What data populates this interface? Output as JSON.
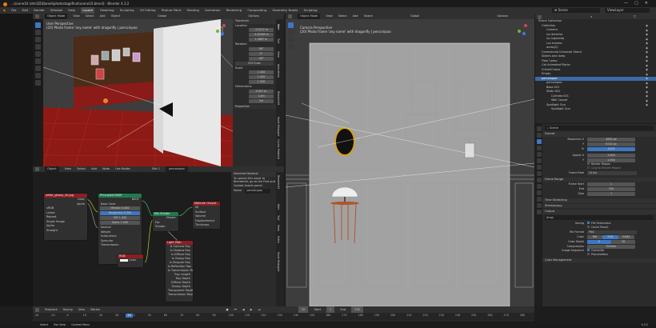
{
  "title": "...\\scene10 (dm\\3D\\Daniel\\photostagefinal\\scene10.blend] - Blender 4.3.2",
  "menu": [
    "File",
    "Edit",
    "Render",
    "Window",
    "Help"
  ],
  "workspace_tabs": [
    "Layout",
    "Modeling",
    "Sculpting",
    "UV Editing",
    "Texture Paint",
    "Shading",
    "Animation",
    "Rendering",
    "Compositing",
    "Geometry Nodes",
    "Scripting"
  ],
  "active_workspace": "Layout",
  "scene_name": "Scene",
  "view_layer": "ViewLayer",
  "left_viewport": {
    "mode": "Object Mode",
    "menus": [
      "View",
      "Select",
      "Add",
      "Object"
    ],
    "orientation": "Global",
    "options": "Options",
    "info_line1": "User Perspective",
    "info_line2": "(20) Photo frame 'any name' with dragonfly | percoinpoo",
    "sidebar_tabs": [
      "Item",
      "Tool",
      "View"
    ],
    "transform": {
      "header": "Transform",
      "location_label": "Location",
      "location": [
        "-3.5222 m",
        "-3.40909 m",
        "1.5887 m"
      ],
      "rotation_label": "Rotation",
      "rotation": [
        "90°",
        "0°",
        "-40°"
      ],
      "rot_mode": "XYZ Euler",
      "scale_label": "Scale",
      "scale": [
        "1.420",
        "1.420",
        "1.420"
      ],
      "dims_label": "Dimensions",
      "dims": [
        "0.957 m",
        "1.4m",
        "1m"
      ],
      "properties": "Properties"
    }
  },
  "camera_viewport": {
    "mode": "Object Mode",
    "menus": [
      "View",
      "Select",
      "Add",
      "Object"
    ],
    "orientation": "Global",
    "options": "Options",
    "info_line1": "Camera Perspective",
    "info_line2": "(20) Photo frame 'any name' with dragonfly | percoinpoo"
  },
  "side_tabs": [
    "Item",
    "Tool",
    "View",
    "Animation",
    "BlenderKit",
    "Node Wrangler",
    "Cycles Material",
    "Extra",
    "MSFS Toolkit"
  ],
  "shader_editor": {
    "editor": "Object",
    "menus": [
      "View",
      "Select",
      "Add",
      "Node"
    ],
    "use_nodes": "Use Nodes",
    "slot": "Slot 1",
    "material": "percoinpoo",
    "sidebar": {
      "header": "Selected Material",
      "line1": "To upload this asset to",
      "line2": "Blenderkit, go to the Find and",
      "line3": "Upload Assets panel.",
      "name_label": "Name",
      "name_value": "percoinpoo"
    },
    "nodes": {
      "image": {
        "title": "white_glossy_4k.jpg",
        "rows": [
          "Color",
          "Alpha",
          "sRGB",
          "Linear",
          "Repeat",
          "Single Image",
          "Alpha",
          "Straight"
        ]
      },
      "bsdf": {
        "title": "Principled BSDF",
        "rows": [
          "BSDF",
          "Base Color",
          "Metallic",
          "Roughness",
          "IOR",
          "Alpha",
          "Normal",
          "Weight",
          "Subsurface",
          "Specular",
          "Transmission",
          "Coat",
          "Sheen",
          "Emission",
          "Thin Film"
        ],
        "values": [
          "0.000",
          "0.500",
          "1.450",
          "1.000"
        ]
      },
      "mix": {
        "title": "Mix Shader",
        "rows": [
          "Shader",
          "Fac",
          "Shader",
          "Shader"
        ]
      },
      "output": {
        "title": "Material Output",
        "rows": [
          "All",
          "Surface",
          "Volume",
          "Displacement",
          "Thickness"
        ]
      },
      "lightpath": {
        "title": "Light Path",
        "rows": [
          "Is Camera Ray",
          "Is Shadow Ray",
          "Is Diffuse Ray",
          "Is Glossy Ray",
          "Is Singular Ray",
          "Is Reflection Ray",
          "Is Transmission Ray",
          "Ray Length",
          "Ray Depth",
          "Diffuse Depth",
          "Glossy Depth",
          "Transparent Depth",
          "Transmission Depth"
        ]
      },
      "rgb": {
        "title": "RGB",
        "value": "Color"
      }
    }
  },
  "outliner": {
    "header": "Scene Collection",
    "rows": [
      "Collection",
      "Camera",
      "luz derecha",
      "luz izquierda",
      "Luz trasera",
      "areas(2)",
      "Commercial Universal Stand",
      "Sliders and lamp",
      "Floor Lamp",
      "Cat Animated Plants",
      "Chine2Chairs",
      "Empty",
      "percoinpoo",
      "percoinpoo",
      "Base.001",
      "Sillón.001",
      "Cylinder.001",
      "Wall Carpet",
      "Spotlight Gun",
      "Spotlight Gun"
    ]
  },
  "properties": {
    "search": "Scene",
    "format": {
      "header": "Format",
      "res_x_label": "Resolution X",
      "res_x": "4850 px",
      "res_y_label": "Y",
      "res_y": "6720 px",
      "pct_label": "%",
      "pct": "100%",
      "aspect_x_label": "Aspect X",
      "aspect_x": "1.000",
      "aspect_y_label": "Y",
      "aspect_y": "1.000",
      "render_region": "Render Region",
      "crop": "Crop to Render Region",
      "fps_label": "Frame Rate",
      "fps": "24 fps"
    },
    "frame_range": {
      "header": "Frame Range",
      "start_label": "Frame Start",
      "start": "1",
      "end_label": "End",
      "end": "250",
      "step_label": "Step",
      "step": "1"
    },
    "time_stretching": "Time Stretching",
    "stereoscopy": "Stereoscopy",
    "output": {
      "header": "Output",
      "path": "/tmp\\",
      "saving_label": "Saving",
      "file_ext": "File Extensions",
      "cache": "Cache Result",
      "format_label": "File Format",
      "format": "PNG",
      "color_label": "Color",
      "color_opts": [
        "BW",
        "RGB",
        "RGBA"
      ],
      "depth_label": "Color Depth",
      "depth_opts": [
        "8",
        "16"
      ],
      "compression_label": "Compression",
      "compression": "Deflate",
      "sequence_label": "Image Sequence",
      "overwrite": "Overwrite",
      "placeholders": "Placeholders"
    },
    "color_management": "Color Management"
  },
  "timeline": {
    "menus": [
      "Playback",
      "Keying",
      "View",
      "Marker"
    ],
    "ticks": [
      "-20",
      "-10",
      "0",
      "10",
      "20",
      "30",
      "40",
      "50",
      "60",
      "70",
      "80",
      "90",
      "100",
      "110",
      "120",
      "130",
      "140",
      "150",
      "160",
      "170",
      "180",
      "190",
      "200",
      "210",
      "220",
      "230",
      "240",
      "250",
      "260",
      "270",
      "280"
    ],
    "current": "20",
    "start_label": "Start",
    "start": "1",
    "end_label": "End",
    "end": "250"
  },
  "status": [
    "Select",
    "Pan View",
    "Context Menu"
  ],
  "version": "4.3.2",
  "colors": {
    "accent": "#3c78c4",
    "active_tab": "#ffffff",
    "selected_row": "#3c6aa6",
    "bsdf_green": "#1f7a4e",
    "mat_red": "#8a1f22"
  }
}
